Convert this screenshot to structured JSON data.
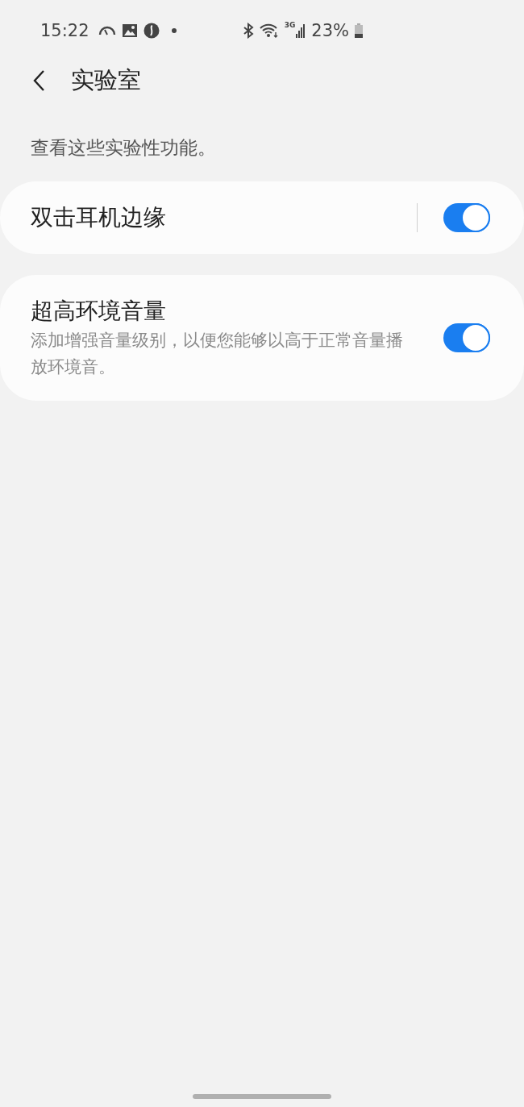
{
  "status_bar": {
    "time": "15:22",
    "network_label": "3G",
    "battery": "23%"
  },
  "header": {
    "title": "实验室"
  },
  "intro": "查看这些实验性功能。",
  "settings": [
    {
      "title": "双击耳机边缘",
      "divider": true,
      "on": true
    },
    {
      "title": "超高环境音量",
      "description": "添加增强音量级别，以便您能够以高于正常音量播放环境音。",
      "divider": false,
      "on": true
    }
  ]
}
